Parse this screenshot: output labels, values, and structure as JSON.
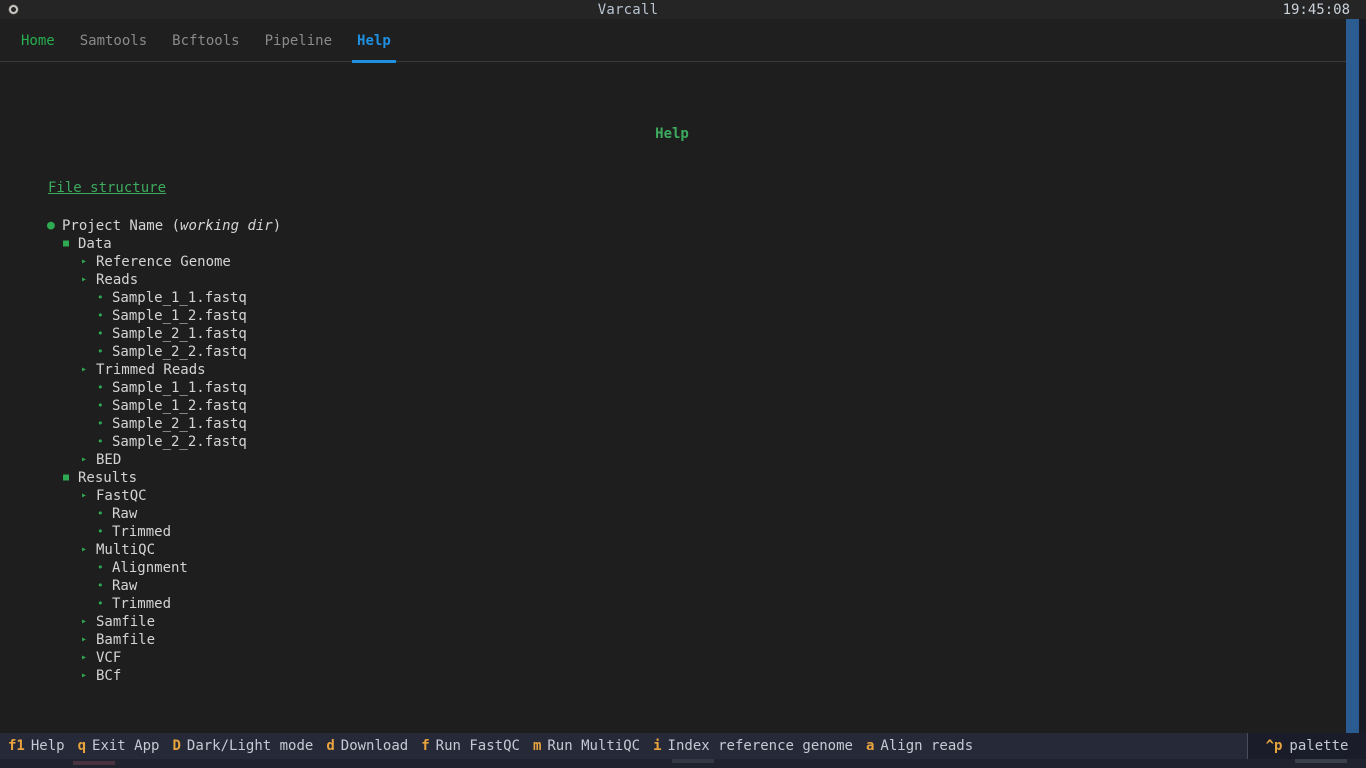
{
  "titlebar": {
    "icon": "app-ring-icon",
    "title": "Varcall",
    "clock": "19:45:08"
  },
  "nav": {
    "items": [
      {
        "label": "Home",
        "state": "home"
      },
      {
        "label": "Samtools",
        "state": "normal"
      },
      {
        "label": "Bcftools",
        "state": "normal"
      },
      {
        "label": "Pipeline",
        "state": "normal"
      },
      {
        "label": "Help",
        "state": "active"
      }
    ]
  },
  "main": {
    "page_title": "Help",
    "section_heading": "File structure",
    "tree": [
      {
        "level": 0,
        "bullet": "disc",
        "text": "Project Name (working dir)",
        "plain": "Project Name ",
        "italic": "working dir"
      },
      {
        "level": 1,
        "bullet": "square",
        "text": "Data"
      },
      {
        "level": 2,
        "bullet": "tri",
        "text": "Reference Genome"
      },
      {
        "level": 2,
        "bullet": "tri",
        "text": "Reads"
      },
      {
        "level": 3,
        "bullet": "dot",
        "text": "Sample_1_1.fastq"
      },
      {
        "level": 3,
        "bullet": "dot",
        "text": "Sample_1_2.fastq"
      },
      {
        "level": 3,
        "bullet": "dot",
        "text": "Sample_2_1.fastq"
      },
      {
        "level": 3,
        "bullet": "dot",
        "text": "Sample_2_2.fastq"
      },
      {
        "level": 2,
        "bullet": "tri",
        "text": "Trimmed Reads"
      },
      {
        "level": 3,
        "bullet": "dot",
        "text": "Sample_1_1.fastq"
      },
      {
        "level": 3,
        "bullet": "dot",
        "text": "Sample_1_2.fastq"
      },
      {
        "level": 3,
        "bullet": "dot",
        "text": "Sample_2_1.fastq"
      },
      {
        "level": 3,
        "bullet": "dot",
        "text": "Sample_2_2.fastq"
      },
      {
        "level": 2,
        "bullet": "tri",
        "text": "BED"
      },
      {
        "level": 1,
        "bullet": "square",
        "text": "Results"
      },
      {
        "level": 2,
        "bullet": "tri",
        "text": "FastQC"
      },
      {
        "level": 3,
        "bullet": "dot",
        "text": "Raw"
      },
      {
        "level": 3,
        "bullet": "dot",
        "text": "Trimmed"
      },
      {
        "level": 2,
        "bullet": "tri",
        "text": "MultiQC"
      },
      {
        "level": 3,
        "bullet": "dot",
        "text": "Alignment"
      },
      {
        "level": 3,
        "bullet": "dot",
        "text": "Raw"
      },
      {
        "level": 3,
        "bullet": "dot",
        "text": "Trimmed"
      },
      {
        "level": 2,
        "bullet": "tri",
        "text": "Samfile"
      },
      {
        "level": 2,
        "bullet": "tri",
        "text": "Bamfile"
      },
      {
        "level": 2,
        "bullet": "tri",
        "text": "VCF"
      },
      {
        "level": 2,
        "bullet": "tri",
        "text": "BCf"
      }
    ]
  },
  "footer": {
    "keys": [
      {
        "key": "f1",
        "desc": "Help"
      },
      {
        "key": "q",
        "desc": "Exit App"
      },
      {
        "key": "D",
        "desc": "Dark/Light mode"
      },
      {
        "key": "d",
        "desc": "Download"
      },
      {
        "key": "f",
        "desc": "Run FastQC"
      },
      {
        "key": "m",
        "desc": "Run MultiQC"
      },
      {
        "key": "i",
        "desc": "Index reference genome"
      },
      {
        "key": "a",
        "desc": "Align reads"
      }
    ],
    "palette": {
      "key": "^p",
      "desc": "palette"
    }
  },
  "colors": {
    "accent_green": "#3cab5e",
    "accent_blue": "#1f8fe0",
    "accent_orange": "#e8a33d",
    "scrollbar_blue": "#2a5c92",
    "background": "#1e1e1e",
    "footer_background": "#262a38"
  }
}
